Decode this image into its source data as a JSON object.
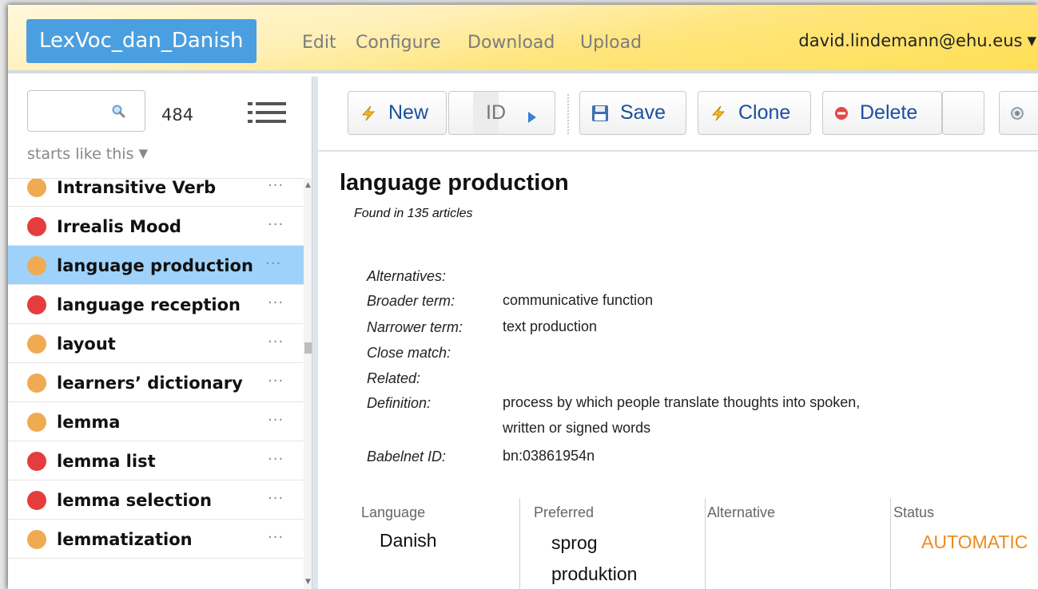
{
  "header": {
    "app_title": "LexVoc_dan_Danish",
    "nav": [
      "Edit",
      "Configure",
      "Download",
      "Upload"
    ],
    "user": "david.lindemann@ehu.eus"
  },
  "sidebar": {
    "search": {
      "value": "",
      "placeholder": ""
    },
    "count": "484",
    "filter_label": "starts like this",
    "items": [
      {
        "label": "Intransitive Verb",
        "status_color": "#f0ab52"
      },
      {
        "label": "Irrealis Mood",
        "status_color": "#e53d3d"
      },
      {
        "label": "language production",
        "status_color": "#f0ab52",
        "selected": true
      },
      {
        "label": "language reception",
        "status_color": "#e53d3d"
      },
      {
        "label": "layout",
        "status_color": "#f0ab52"
      },
      {
        "label": "learners’ dictionary",
        "status_color": "#f0ab52"
      },
      {
        "label": "lemma",
        "status_color": "#f0ab52"
      },
      {
        "label": "lemma list",
        "status_color": "#e53d3d"
      },
      {
        "label": "lemma selection",
        "status_color": "#e53d3d"
      },
      {
        "label": "lemmatization",
        "status_color": "#f0ab52"
      }
    ],
    "more_glyph": "···"
  },
  "toolbar": {
    "new_label": "New",
    "id_label": "ID",
    "save_label": "Save",
    "clone_label": "Clone",
    "delete_label": "Delete"
  },
  "detail": {
    "title": "language production",
    "found_in": "Found in 135 articles",
    "properties": {
      "alternatives_label": "Alternatives:",
      "broader_label": "Broader term:",
      "broader_value": "communicative function",
      "narrower_label": "Narrower term:",
      "narrower_value": "text production",
      "close_match_label": "Close match:",
      "related_label": "Related:",
      "definition_label": "Definition:",
      "definition_line1": "process by which people translate thoughts into spoken,",
      "definition_line2": "written or signed words",
      "babelnet_label": "Babelnet ID:",
      "babelnet_value": "bn:03861954n"
    },
    "table": {
      "headers": [
        "Language",
        "Preferred",
        "Alternative",
        "Status"
      ],
      "row": {
        "language": "Danish",
        "preferred_line1": "sprog",
        "preferred_line2": "produktion",
        "alternative": "",
        "status": "AUTOMATIC"
      }
    }
  },
  "colors": {
    "accent": "#4a9fe0",
    "selected_row": "#9ed2fb",
    "status_automatic": "#f08a1c",
    "link_blue": "#1a4fa0"
  }
}
